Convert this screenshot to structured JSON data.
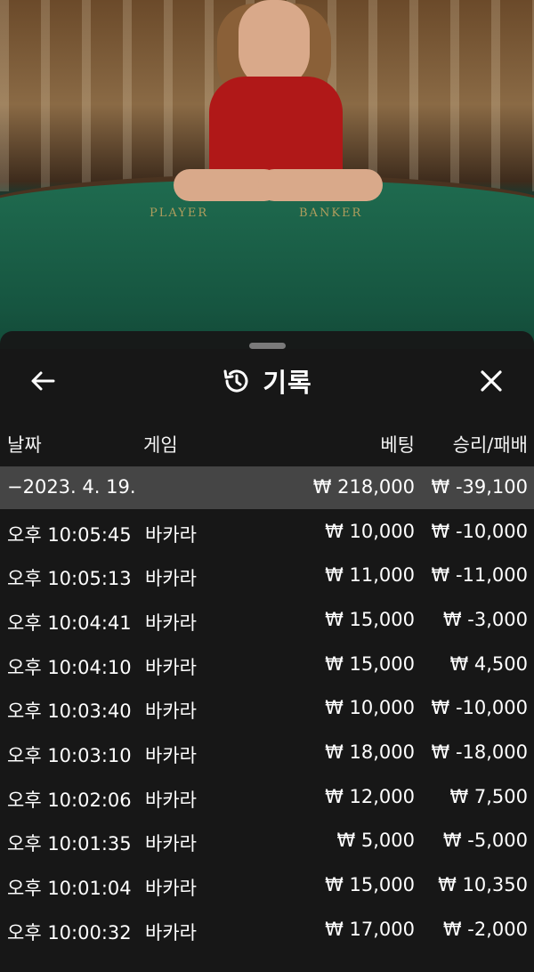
{
  "header": {
    "title": "기록"
  },
  "columns": {
    "date": "날짜",
    "game": "게임",
    "bet": "베팅",
    "result": "승리/패배"
  },
  "summary": {
    "date": "−2023. 4. 19.",
    "bet": "₩ 218,000",
    "result": "₩ -39,100"
  },
  "records": [
    {
      "time": "오후 10:05:45",
      "game": "바카라",
      "bet": "₩ 10,000",
      "result": "₩ -10,000"
    },
    {
      "time": "오후 10:05:13",
      "game": "바카라",
      "bet": "₩ 11,000",
      "result": "₩ -11,000"
    },
    {
      "time": "오후 10:04:41",
      "game": "바카라",
      "bet": "₩ 15,000",
      "result": "₩ -3,000"
    },
    {
      "time": "오후 10:04:10",
      "game": "바카라",
      "bet": "₩ 15,000",
      "result": "₩ 4,500"
    },
    {
      "time": "오후 10:03:40",
      "game": "바카라",
      "bet": "₩ 10,000",
      "result": "₩ -10,000"
    },
    {
      "time": "오후 10:03:10",
      "game": "바카라",
      "bet": "₩ 18,000",
      "result": "₩ -18,000"
    },
    {
      "time": "오후 10:02:06",
      "game": "바카라",
      "bet": "₩ 12,000",
      "result": "₩ 7,500"
    },
    {
      "time": "오후 10:01:35",
      "game": "바카라",
      "bet": "₩ 5,000",
      "result": "₩ -5,000"
    },
    {
      "time": "오후 10:01:04",
      "game": "바카라",
      "bet": "₩ 15,000",
      "result": "₩ 10,350"
    },
    {
      "time": "오후 10:00:32",
      "game": "바카라",
      "bet": "₩ 17,000",
      "result": "₩ -2,000"
    }
  ],
  "video": {
    "table_label_player": "PLAYER",
    "table_label_banker": "BANKER"
  },
  "icons": {
    "back": "arrow-left-icon",
    "history": "history-icon",
    "close": "close-icon"
  }
}
